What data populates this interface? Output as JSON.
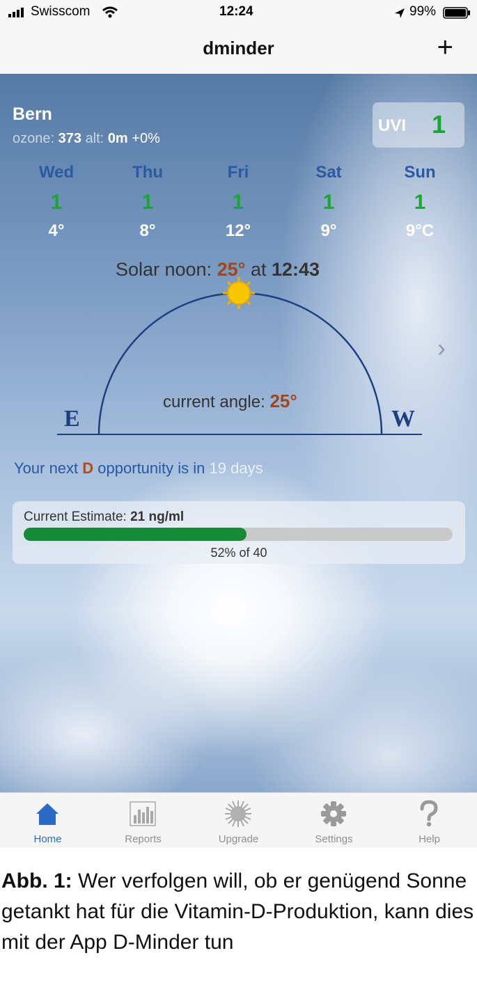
{
  "status": {
    "carrier": "Swisscom",
    "time": "12:24",
    "battery": "99%"
  },
  "nav": {
    "title": "dminder",
    "add_icon": "plus-icon"
  },
  "location": {
    "city": "Bern",
    "ozone_label": "ozone:",
    "ozone_value": "373",
    "alt_label": "alt:",
    "alt_value": "0m",
    "alt_change": "+0%"
  },
  "uvi": {
    "label": "UVI",
    "value": "1"
  },
  "forecast": [
    {
      "day": "Wed",
      "uv": "1",
      "temp": "4°"
    },
    {
      "day": "Thu",
      "uv": "1",
      "temp": "8°"
    },
    {
      "day": "Fri",
      "uv": "1",
      "temp": "12°"
    },
    {
      "day": "Sat",
      "uv": "1",
      "temp": "9°"
    },
    {
      "day": "Sun",
      "uv": "1",
      "temp": "9°C"
    }
  ],
  "solar": {
    "noon_label": "Solar noon:",
    "noon_angle": "25°",
    "at_label": "at",
    "noon_time": "12:43",
    "current_label": "current angle:",
    "current_angle": "25°",
    "east": "E",
    "west": "W"
  },
  "opportunity": {
    "prefix": "Your next",
    "d": "D",
    "middle": "opportunity is in",
    "days": "19 days"
  },
  "estimate": {
    "label": "Current Estimate:",
    "value": "21 ng/ml",
    "progress": 0.52,
    "percent_text": "52% of 40"
  },
  "colors": {
    "uv_green": "#1aa535",
    "day_blue": "#2a5aa0",
    "accent_orange": "#a0461c",
    "progress_green": "#168a36",
    "tab_active": "#2a6ac4"
  },
  "tabs": [
    {
      "label": "Home",
      "icon": "home-icon",
      "active": true
    },
    {
      "label": "Reports",
      "icon": "bar-chart-icon",
      "active": false
    },
    {
      "label": "Upgrade",
      "icon": "sun-icon",
      "active": false
    },
    {
      "label": "Settings",
      "icon": "gear-icon",
      "active": false
    },
    {
      "label": "Help",
      "icon": "question-icon",
      "active": false
    }
  ],
  "caption": {
    "bold": "Abb. 1:",
    "text": "Wer verfolgen will, ob er genügend Sonne getankt hat für die Vitamin-D-Produktion, kann dies mit der App D-Minder tun"
  }
}
